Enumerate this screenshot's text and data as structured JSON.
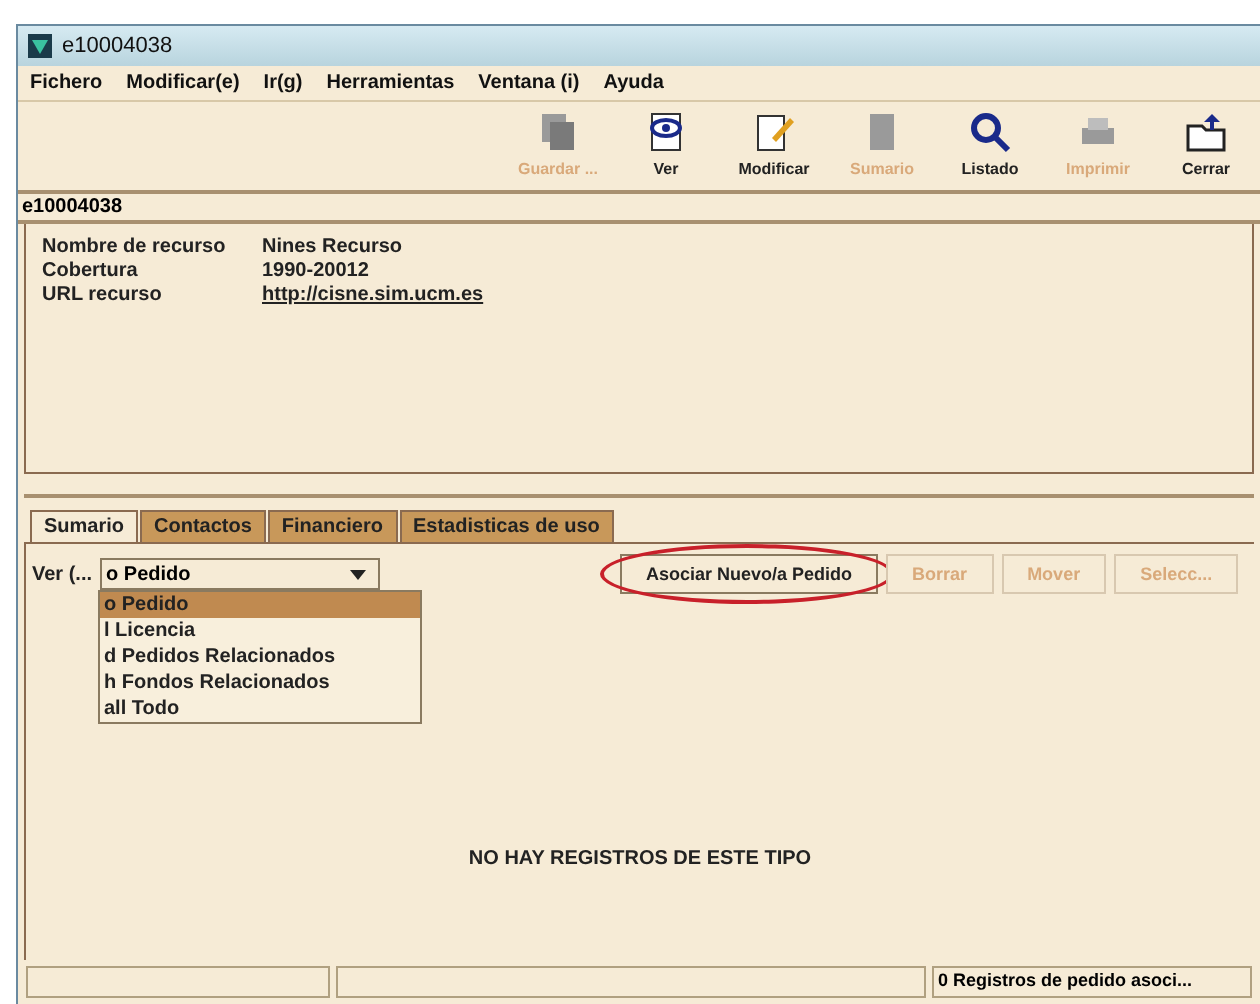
{
  "window": {
    "title": "e10004038"
  },
  "menu": [
    "Fichero",
    "Modificar(e)",
    "Ir(g)",
    "Herramientas",
    "Ventana (i)",
    "Ayuda"
  ],
  "toolbar": [
    {
      "kind": "copy",
      "label": "Guardar ...",
      "disabled": true
    },
    {
      "kind": "view",
      "label": "Ver",
      "disabled": false
    },
    {
      "kind": "edit",
      "label": "Modificar",
      "disabled": false
    },
    {
      "kind": "doc",
      "label": "Sumario",
      "disabled": true
    },
    {
      "kind": "search",
      "label": "Listado",
      "disabled": false
    },
    {
      "kind": "print",
      "label": "Imprimir",
      "disabled": true
    },
    {
      "kind": "folder",
      "label": "Cerrar",
      "disabled": false
    }
  ],
  "record_id": "e10004038",
  "fields": [
    {
      "label": "Nombre de recurso",
      "value": "Nines Recurso",
      "link": false
    },
    {
      "label": "Cobertura",
      "value": "1990-20012",
      "link": false
    },
    {
      "label": "URL recurso",
      "value": "http://cisne.sim.ucm.es",
      "link": true
    }
  ],
  "tabs": [
    {
      "label": "Sumario",
      "selected": true
    },
    {
      "label": "Contactos",
      "selected": false
    },
    {
      "label": "Financiero",
      "selected": false
    },
    {
      "label": "Estadisticas de uso",
      "selected": false
    }
  ],
  "view_label": "Ver (...",
  "view_select": {
    "value": "o Pedido",
    "options": [
      {
        "label": "o Pedido",
        "selected": true
      },
      {
        "label": "l Licencia",
        "selected": false
      },
      {
        "label": "d Pedidos Relacionados",
        "selected": false
      },
      {
        "label": "h Fondos Relacionados",
        "selected": false
      },
      {
        "label": "all Todo",
        "selected": false
      }
    ]
  },
  "actions": [
    {
      "label": "Asociar Nuevo/a Pedido",
      "disabled": false,
      "highlighted": true
    },
    {
      "label": "Borrar",
      "disabled": true,
      "highlighted": false
    },
    {
      "label": "Mover",
      "disabled": true,
      "highlighted": false
    },
    {
      "label": "Selecc...",
      "disabled": true,
      "highlighted": false
    }
  ],
  "empty_message": "NO HAY REGISTROS DE ESTE TIPO",
  "status_bar": {
    "message": "0 Registros de pedido asoci..."
  }
}
